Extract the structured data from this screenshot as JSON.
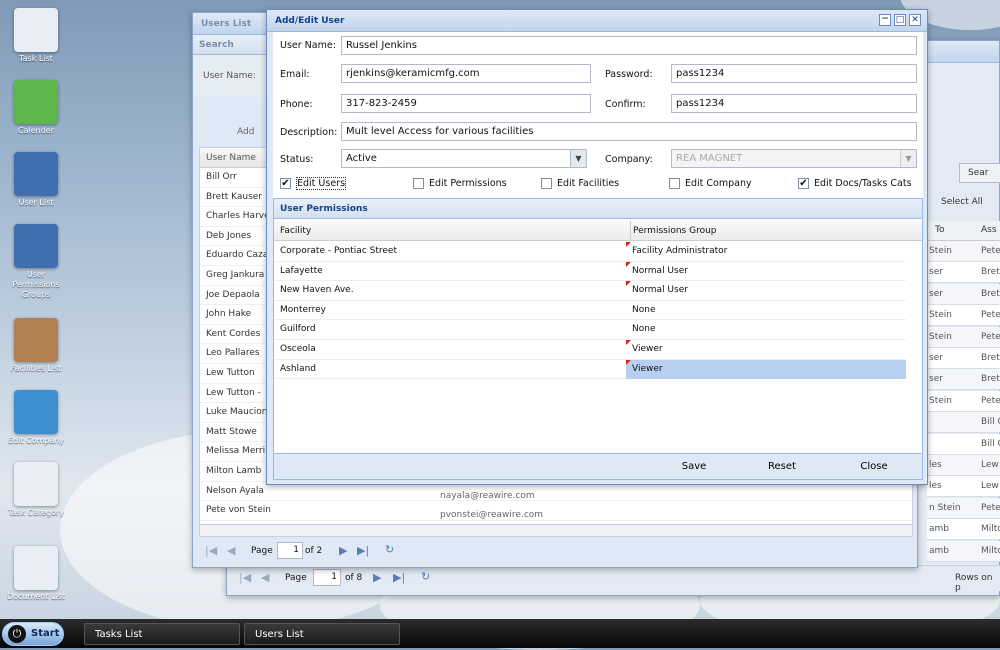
{
  "desktop": {
    "icons": [
      {
        "label": "Task List",
        "color": "#e9eef6"
      },
      {
        "label": "Calender",
        "color": "#5cb84a"
      },
      {
        "label": "User List",
        "color": "#3f6fb0"
      },
      {
        "label": "User Permissions Groups",
        "color": "#3f6fb0"
      },
      {
        "label": "Facilities List",
        "color": "#b08050"
      },
      {
        "label": "Edit Company",
        "color": "#3d8fcf"
      },
      {
        "label": "Task Category",
        "color": "#e9eef6"
      },
      {
        "label": "Document List",
        "color": "#e9eef6"
      }
    ]
  },
  "back_window": {
    "pager": {
      "page_label": "Page",
      "page_value": "1",
      "of_label": "of 8"
    },
    "right_labels": {
      "search": "Sear",
      "select_all": "Select All",
      "col_to": "To",
      "col_ass": "Ass",
      "rows": "Rows on p"
    },
    "right_rows": [
      [
        "Stein",
        "Pete"
      ],
      [
        "ser",
        "Bret"
      ],
      [
        "ser",
        "Bret"
      ],
      [
        "Stein",
        "Pete"
      ],
      [
        "Stein",
        "Pete"
      ],
      [
        "ser",
        "Bret"
      ],
      [
        "ser",
        "Bret"
      ],
      [
        "Stein",
        "Pete"
      ],
      [
        "",
        "Bill C"
      ],
      [
        "",
        "Bill C"
      ],
      [
        "les",
        "Lew"
      ],
      [
        "les",
        "Lew"
      ],
      [
        "n Stein",
        "Pete"
      ],
      [
        "amb",
        "Milto"
      ],
      [
        "amb",
        "Milto"
      ]
    ]
  },
  "users_window": {
    "title": "Users List",
    "search_title": "Search",
    "username_label": "User Name:",
    "add_label": "Add",
    "col_user": "User Name",
    "users": [
      "Bill Orr",
      "Brett Kauser",
      "Charles Harve",
      "Deb Jones",
      "Eduardo Caza",
      "Greg Jankura",
      "Joe Depaola",
      "John Hake",
      "Kent Cordes",
      "Leo Pallares",
      "Lew Tutton",
      "Lew Tutton -",
      "Luke Maucion",
      "Matt Stowe",
      "Melissa Merri",
      "Milton Lamb",
      "Nelson Ayala",
      "Pete von Stein"
    ],
    "emails": {
      "nelson": "nayala@reawire.com",
      "pete": "pvonstei@reawire.com"
    },
    "pager": {
      "page_label": "Page",
      "page_value": "1",
      "of_label": "of 2"
    }
  },
  "dialog": {
    "title": "Add/Edit User",
    "labels": {
      "username": "User Name:",
      "email": "Email:",
      "password": "Password:",
      "phone": "Phone:",
      "confirm": "Confirm:",
      "description": "Description:",
      "status": "Status:",
      "company": "Company:"
    },
    "values": {
      "username": "Russel Jenkins",
      "email": "rjenkins@keramicmfg.com",
      "password": "pass1234",
      "phone": "317-823-2459",
      "confirm": "pass1234",
      "description": "Mult level Access for various facilities",
      "status": "Active",
      "company": "REA MAGNET"
    },
    "checkboxes": [
      {
        "label": "Edit Users",
        "checked": "✔"
      },
      {
        "label": "Edit Permissions",
        "checked": ""
      },
      {
        "label": "Edit Facilities",
        "checked": ""
      },
      {
        "label": "Edit Company",
        "checked": ""
      },
      {
        "label": "Edit Docs/Tasks Cats",
        "checked": "✔"
      }
    ],
    "permissions": {
      "title": "User Permissions",
      "col_facility": "Facility",
      "col_group": "Permissions Group",
      "rows": [
        {
          "facility": "Corporate - Pontiac Street",
          "group": "Facility Administrator"
        },
        {
          "facility": "Lafayette",
          "group": "Normal User"
        },
        {
          "facility": "New Haven Ave.",
          "group": "Normal User"
        },
        {
          "facility": "Monterrey",
          "group": "None"
        },
        {
          "facility": "Guilford",
          "group": "None"
        },
        {
          "facility": "Osceola",
          "group": "Viewer"
        },
        {
          "facility": "Ashland",
          "group": "Viewer"
        }
      ]
    },
    "buttons": {
      "save": "Save",
      "reset": "Reset",
      "close": "Close"
    }
  },
  "taskbar": {
    "start": "Start",
    "tasks": [
      "Tasks List",
      "Users List"
    ]
  }
}
